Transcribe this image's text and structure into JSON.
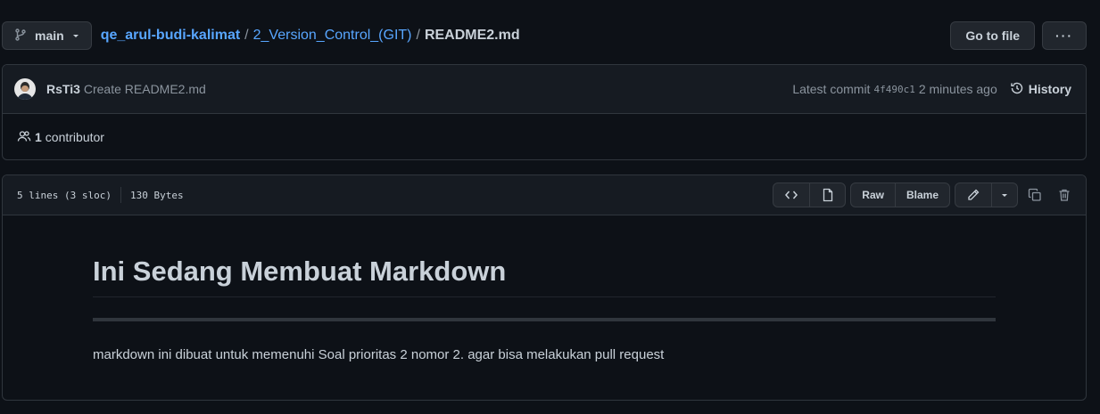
{
  "branch": {
    "label": "main",
    "icon": "git-branch-icon"
  },
  "breadcrumb": {
    "repo": "qe_arul-budi-kalimat",
    "folder": "2_Version_Control_(GIT)",
    "separator": "/",
    "file": "README2.md"
  },
  "toolbar": {
    "go_to_file": "Go to file",
    "more": "···"
  },
  "commit": {
    "author": "RsTi3",
    "message": "Create README2.md",
    "latest_label": "Latest commit",
    "sha": "4f490c1",
    "time": "2 minutes ago",
    "history_label": "History"
  },
  "contributors": {
    "count": "1",
    "label": "contributor"
  },
  "file": {
    "lines": "5 lines (3 sloc)",
    "size": "130 Bytes",
    "raw_label": "Raw",
    "blame_label": "Blame"
  },
  "content": {
    "heading": "Ini Sedang Membuat Markdown",
    "paragraph": "markdown ini dibuat untuk memenuhi Soal prioritas 2 nomor 2. agar bisa melakukan pull request"
  },
  "colors": {
    "background": "#0d1117",
    "header_bg": "#161b22",
    "border": "#30363d",
    "link": "#58a6ff",
    "text": "#c9d1d9",
    "muted": "#8b949e"
  }
}
